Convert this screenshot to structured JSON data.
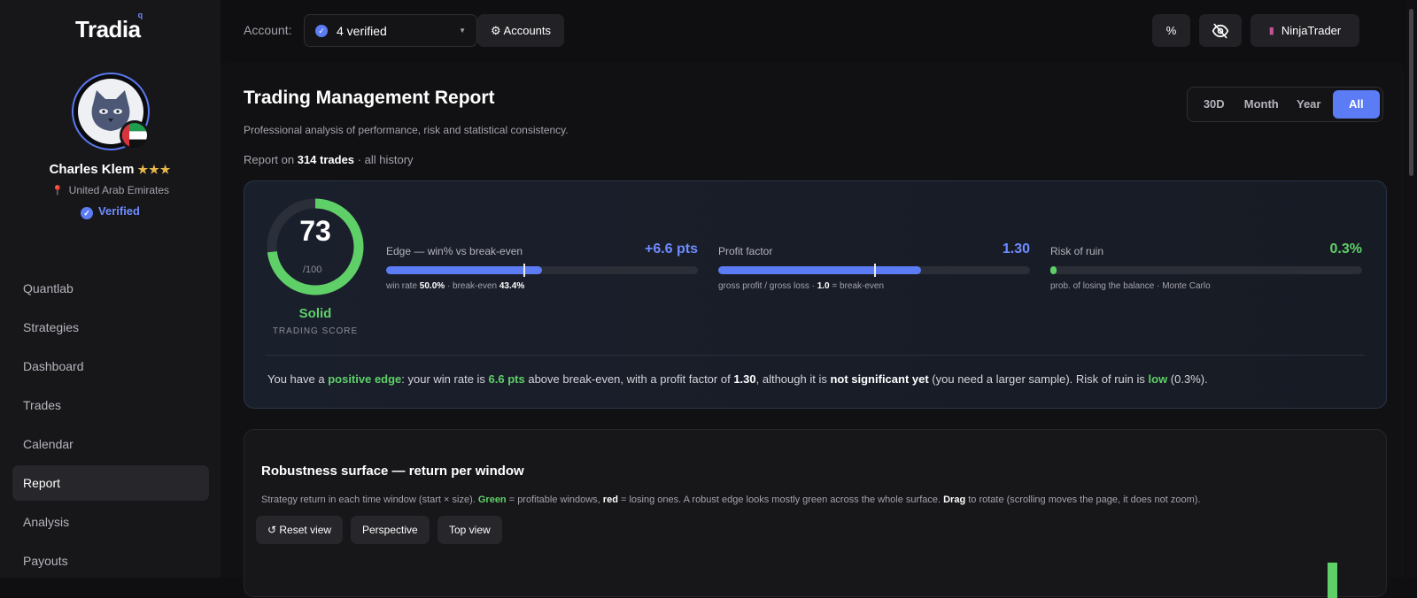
{
  "brand": {
    "name": "Tradia",
    "mark": "q"
  },
  "user": {
    "name": "Charles Klem",
    "stars": "★★★",
    "location": "United Arab Emirates",
    "verified": "Verified"
  },
  "nav": {
    "items": [
      "Quantlab",
      "Strategies",
      "Dashboard",
      "Trades",
      "Calendar",
      "Report",
      "Analysis",
      "Payouts"
    ],
    "active": "Report"
  },
  "topbar": {
    "account_label": "Account:",
    "account_value": "4 verified",
    "accounts_button": "⚙ Accounts",
    "percent_button": "%",
    "platform_button": "NinjaTrader"
  },
  "report": {
    "title": "Trading Management Report",
    "subtitle": "Professional analysis of performance, risk and statistical consistency.",
    "report_prefix": "Report on",
    "trades": "314 trades",
    "history": "· all history",
    "periods": [
      "30D",
      "Month",
      "Year",
      "All"
    ],
    "active_period": "All"
  },
  "score": {
    "value": "73",
    "denominator": "/100",
    "fraction": 0.73,
    "label": "Solid",
    "caption": "TRADING SCORE",
    "metrics": [
      {
        "label": "Edge — win% vs break-even",
        "value": "+6.6 pts",
        "fill": 0.5,
        "marker": 0.44,
        "note_parts": [
          "win rate ",
          "50.0%",
          " · break-even ",
          "43.4%"
        ]
      },
      {
        "label": "Profit factor",
        "value": "1.30",
        "fill": 0.65,
        "marker": 0.5,
        "note_parts": [
          "gross profit / gross loss · ",
          "1.0",
          " = break-even"
        ]
      },
      {
        "label": "Risk of ruin",
        "value": "0.3%",
        "fill": 0.015,
        "note_parts": [
          "prob. of losing the balance · Monte Carlo"
        ]
      }
    ],
    "summary_parts": [
      "You have a ",
      "positive edge",
      ": your win rate is ",
      "6.6 pts",
      " above break-even, with a profit factor of ",
      "1.30",
      ", although it is ",
      "not significant yet",
      " (you need a larger sample). Risk of ruin is ",
      "low",
      " (0.3%)."
    ]
  },
  "robustness": {
    "title": "Robustness surface — return per window",
    "desc_parts": [
      "Strategy return in each time window (start × size). ",
      "Green",
      " = profitable windows, ",
      "red",
      " = losing ones. A robust edge looks mostly green across the whole surface. ",
      "Drag",
      " to rotate (scrolling moves the page, it does not zoom)."
    ],
    "buttons": [
      "↺ Reset view",
      "Perspective",
      "Top view"
    ]
  },
  "colors": {
    "accent": "#5c7cf5",
    "positive": "#5fd068",
    "blue_value": "#6f8cff"
  }
}
